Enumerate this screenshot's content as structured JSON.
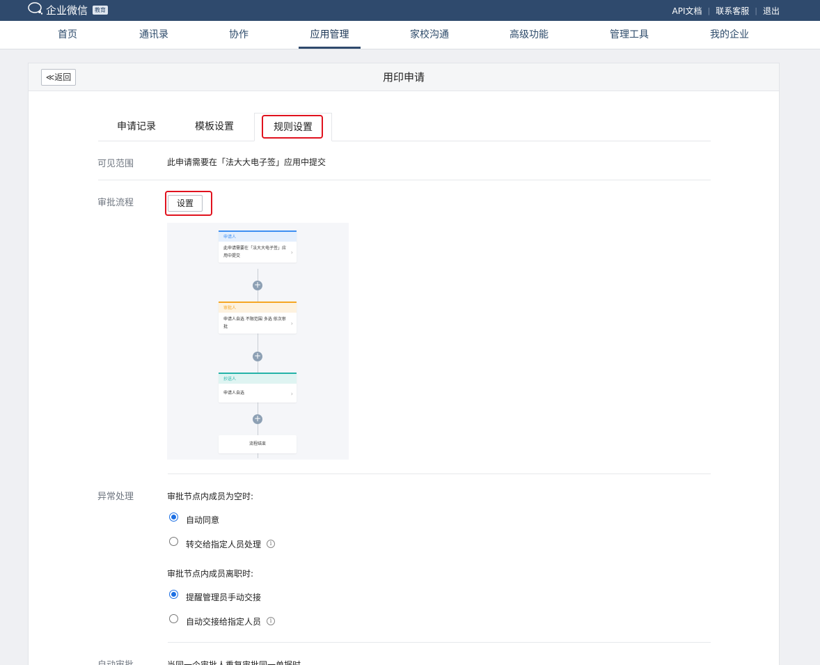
{
  "topbar": {
    "app_name": "企业微信",
    "badge": "教育",
    "links": [
      "API文档",
      "联系客服",
      "退出"
    ]
  },
  "nav": {
    "items": [
      "首页",
      "通讯录",
      "协作",
      "应用管理",
      "家校沟通",
      "高级功能",
      "管理工具",
      "我的企业"
    ],
    "active": "应用管理"
  },
  "page": {
    "back_label": "≪返回",
    "title": "用印申请",
    "tabs": [
      "申请记录",
      "模板设置",
      "规则设置"
    ],
    "active_tab": "规则设置"
  },
  "visibility": {
    "label": "可见范围",
    "text": "此申请需要在「法大大电子签」应用中提交"
  },
  "approval": {
    "label": "审批流程",
    "button": "设置",
    "flow": {
      "applicant": {
        "head": "申请人",
        "body": "此申请需要在「法大大电子签」应用中提交"
      },
      "approver": {
        "head": "审批人",
        "body": "申请人自选 不限范围 多选 依次审批"
      },
      "cc": {
        "head": "抄送人",
        "body": "申请人自选"
      },
      "end": "流程结束",
      "plus": "+",
      "chevron": "›"
    }
  },
  "exception": {
    "label": "异常处理",
    "empty_title": "审批节点内成员为空时:",
    "empty_options": [
      "自动同意",
      "转交给指定人员处理"
    ],
    "left_title": "审批节点内成员离职时:",
    "left_options": [
      "提醒管理员手动交接",
      "自动交接给指定人员"
    ],
    "info_glyph": "i"
  },
  "auto": {
    "label": "自动审批",
    "text": "当同一个审批人重复审批同一单据时"
  },
  "colors": {
    "applicant_accent": "#3d8ff2",
    "approver_accent": "#f5a623",
    "cc_accent": "#24b3a8",
    "highlight_red": "#e0121e"
  }
}
